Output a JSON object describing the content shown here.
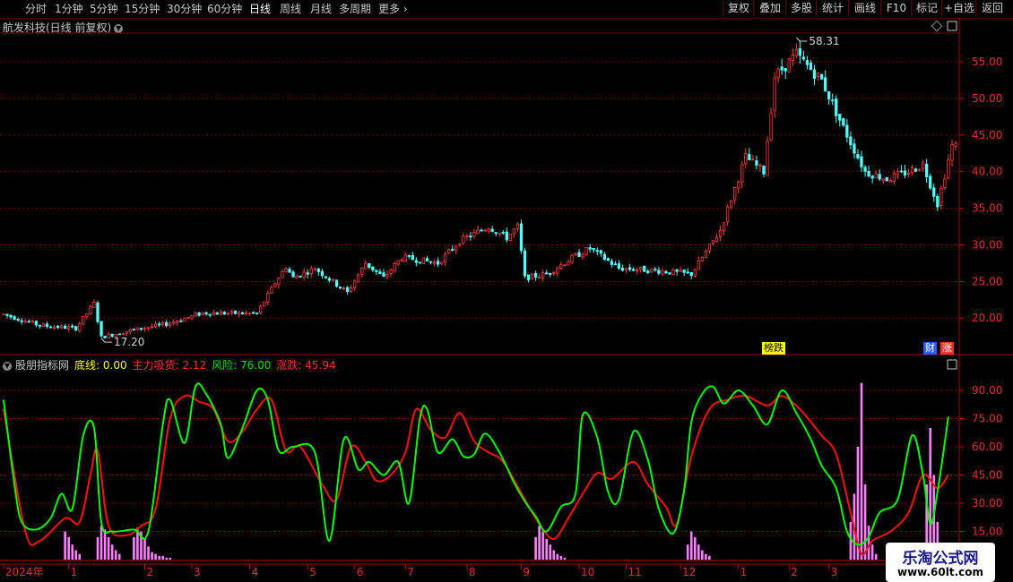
{
  "toolbar": {
    "periods": [
      "分时",
      "1分钟",
      "5分钟",
      "15分钟",
      "30分钟",
      "60分钟",
      "日线",
      "周线",
      "月线",
      "多周期",
      "更多"
    ],
    "active": "日线",
    "right_buttons": [
      "复权",
      "叠加",
      "多股",
      "统计",
      "画线",
      "F10",
      "标记",
      "+自选",
      "返回"
    ]
  },
  "main_title": "航发科技(日线 前复权)",
  "badges": {
    "bang": "榜跌",
    "cai": "财",
    "zhang": "涨"
  },
  "indicator": {
    "name": "股朋指标网",
    "items": [
      {
        "label": "底线: ",
        "value": "0.00",
        "color": "#ffff00"
      },
      {
        "label": "主力吸货: ",
        "value": "2.12",
        "color": "#ff3030"
      },
      {
        "label": "风险: ",
        "value": "76.00",
        "color": "#00e000"
      },
      {
        "label": "涨跌: ",
        "value": "45.94",
        "color": "#ff3030"
      }
    ]
  },
  "watermark": {
    "title": "乐淘公式网",
    "url": "www.60lt.com"
  },
  "colors": {
    "up": "#ff3a3a",
    "down": "#54ffff",
    "green_line": "#00ff00",
    "red_line": "#ff1010",
    "bars": "#ff80ff",
    "grid": "#7a0000"
  },
  "chart_data": [
    {
      "type": "candlestick",
      "ylim": [
        15.5,
        58.8
      ],
      "y_ticks": [
        "55.00",
        "50.00",
        "45.00",
        "40.00",
        "35.00",
        "30.00",
        "25.00",
        "20.00"
      ],
      "y_tick_values": [
        55,
        50,
        45,
        40,
        35,
        30,
        25,
        20
      ],
      "annotations": [
        {
          "text": "58.31",
          "value": 58.31,
          "bar_index": 219
        },
        {
          "text": "17.20",
          "value": 17.2,
          "bar_index": 27
        }
      ],
      "price_path": [
        [
          0,
          20.5
        ],
        [
          10,
          19.0
        ],
        [
          20,
          18.6
        ],
        [
          25,
          22
        ],
        [
          27,
          17.4
        ],
        [
          35,
          18.3
        ],
        [
          45,
          19.2
        ],
        [
          55,
          20.7
        ],
        [
          70,
          20.6
        ],
        [
          75,
          24.8
        ],
        [
          78,
          27
        ],
        [
          80,
          25.5
        ],
        [
          86,
          26.8
        ],
        [
          95,
          23.5
        ],
        [
          100,
          27.5
        ],
        [
          105,
          25.5
        ],
        [
          110,
          28.3
        ],
        [
          120,
          27.5
        ],
        [
          126,
          30.5
        ],
        [
          134,
          32.5
        ],
        [
          139,
          31
        ],
        [
          142,
          32.5
        ],
        [
          144,
          25.5
        ],
        [
          150,
          26
        ],
        [
          158,
          28.5
        ],
        [
          162,
          29.5
        ],
        [
          170,
          26.8
        ],
        [
          180,
          26.5
        ],
        [
          190,
          26
        ],
        [
          198,
          32
        ],
        [
          205,
          42
        ],
        [
          210,
          40
        ],
        [
          213,
          53
        ],
        [
          219,
          56
        ],
        [
          226,
          52.5
        ],
        [
          232,
          46
        ],
        [
          238,
          40
        ],
        [
          244,
          39
        ],
        [
          250,
          40
        ],
        [
          254,
          41
        ],
        [
          258,
          35.6
        ],
        [
          262,
          43.5
        ]
      ]
    },
    {
      "type": "line",
      "ylim": [
        0,
        100
      ],
      "y_ticks": [
        "90.00",
        "75.00",
        "60.00",
        "45.00",
        "30.00",
        "15.00"
      ],
      "y_tick_values": [
        90,
        75,
        60,
        45,
        30,
        15
      ],
      "series": [
        {
          "name": "风险",
          "color": "#00ff00",
          "values": [
            [
              0,
              85
            ],
            [
              3,
              40
            ],
            [
              5,
              20
            ],
            [
              9,
              16
            ],
            [
              13,
              22
            ],
            [
              16,
              35
            ],
            [
              19,
              27
            ],
            [
              22,
              66
            ],
            [
              25,
              70
            ],
            [
              27,
              20
            ],
            [
              30,
              15
            ],
            [
              36,
              16
            ],
            [
              40,
              15
            ],
            [
              44,
              72
            ],
            [
              46,
              85
            ],
            [
              50,
              62
            ],
            [
              53,
              92
            ],
            [
              56,
              88
            ],
            [
              60,
              72
            ],
            [
              62,
              54
            ],
            [
              66,
              70
            ],
            [
              70,
              90
            ],
            [
              73,
              85
            ],
            [
              76,
              58
            ],
            [
              80,
              60
            ],
            [
              86,
              57
            ],
            [
              90,
              10
            ],
            [
              94,
              64
            ],
            [
              98,
              48
            ],
            [
              101,
              52
            ],
            [
              105,
              45
            ],
            [
              109,
              52
            ],
            [
              112,
              30
            ],
            [
              115,
              75
            ],
            [
              117,
              80
            ],
            [
              120,
              57
            ],
            [
              124,
              64
            ],
            [
              127,
              55
            ],
            [
              130,
              56
            ],
            [
              133,
              67
            ],
            [
              137,
              57
            ],
            [
              141,
              41
            ],
            [
              144,
              31
            ],
            [
              147,
              23
            ],
            [
              150,
              15
            ],
            [
              154,
              28
            ],
            [
              158,
              35
            ],
            [
              160,
              77
            ],
            [
              164,
              65
            ],
            [
              167,
              36
            ],
            [
              170,
              32
            ],
            [
              174,
              68
            ],
            [
              178,
              53
            ],
            [
              181,
              27
            ],
            [
              185,
              14
            ],
            [
              188,
              37
            ],
            [
              190,
              73
            ],
            [
              193,
              88
            ],
            [
              196,
              92
            ],
            [
              199,
              83
            ],
            [
              203,
              90
            ],
            [
              207,
              82
            ],
            [
              211,
              72
            ],
            [
              215,
              90
            ],
            [
              219,
              78
            ],
            [
              223,
              64
            ],
            [
              226,
              50
            ],
            [
              230,
              38
            ],
            [
              233,
              15
            ],
            [
              236,
              8
            ],
            [
              239,
              12
            ],
            [
              242,
              25
            ],
            [
              247,
              32
            ],
            [
              251,
              66
            ],
            [
              254,
              45
            ],
            [
              256,
              19
            ],
            [
              258,
              36
            ],
            [
              261,
              76
            ]
          ]
        },
        {
          "name": "涨跌",
          "color": "#ff1010",
          "values": [
            [
              0,
              80
            ],
            [
              6,
              15
            ],
            [
              10,
              10
            ],
            [
              17,
              22
            ],
            [
              21,
              20
            ],
            [
              24,
              45
            ],
            [
              26,
              58
            ],
            [
              29,
              18
            ],
            [
              34,
              13
            ],
            [
              38,
              18
            ],
            [
              42,
              27
            ],
            [
              46,
              75
            ],
            [
              50,
              87
            ],
            [
              54,
              84
            ],
            [
              58,
              80
            ],
            [
              62,
              63
            ],
            [
              66,
              68
            ],
            [
              70,
              80
            ],
            [
              74,
              85
            ],
            [
              78,
              58
            ],
            [
              82,
              60
            ],
            [
              88,
              40
            ],
            [
              92,
              32
            ],
            [
              96,
              60
            ],
            [
              100,
              52
            ],
            [
              103,
              42
            ],
            [
              107,
              45
            ],
            [
              111,
              57
            ],
            [
              114,
              80
            ],
            [
              118,
              69
            ],
            [
              122,
              65
            ],
            [
              126,
              78
            ],
            [
              130,
              63
            ],
            [
              134,
              57
            ],
            [
              138,
              52
            ],
            [
              144,
              32
            ],
            [
              148,
              19
            ],
            [
              152,
              11
            ],
            [
              156,
              22
            ],
            [
              160,
              35
            ],
            [
              164,
              46
            ],
            [
              168,
              43
            ],
            [
              174,
              52
            ],
            [
              178,
              40
            ],
            [
              183,
              28
            ],
            [
              186,
              19
            ],
            [
              190,
              55
            ],
            [
              195,
              80
            ],
            [
              200,
              85
            ],
            [
              205,
              87
            ],
            [
              211,
              82
            ],
            [
              215,
              87
            ],
            [
              220,
              80
            ],
            [
              226,
              66
            ],
            [
              230,
              56
            ],
            [
              234,
              25
            ],
            [
              237,
              3
            ],
            [
              240,
              10
            ],
            [
              245,
              15
            ],
            [
              250,
              25
            ],
            [
              254,
              45
            ],
            [
              258,
              38
            ],
            [
              261,
              45
            ]
          ]
        },
        {
          "name": "主力吸货",
          "color": "#ff80ff",
          "bars": [
            [
              17,
              15
            ],
            [
              18,
              12
            ],
            [
              19,
              8
            ],
            [
              20,
              5
            ],
            [
              21,
              3
            ],
            [
              26,
              12
            ],
            [
              27,
              18
            ],
            [
              28,
              16
            ],
            [
              29,
              12
            ],
            [
              30,
              8
            ],
            [
              31,
              5
            ],
            [
              32,
              3
            ],
            [
              36,
              12
            ],
            [
              37,
              17
            ],
            [
              38,
              15
            ],
            [
              39,
              11
            ],
            [
              40,
              7
            ],
            [
              41,
              4
            ],
            [
              42,
              3
            ],
            [
              43,
              2
            ],
            [
              44,
              2
            ],
            [
              45,
              1
            ],
            [
              46,
              1
            ],
            [
              147,
              12
            ],
            [
              148,
              18
            ],
            [
              149,
              15
            ],
            [
              150,
              11
            ],
            [
              151,
              8
            ],
            [
              152,
              5
            ],
            [
              153,
              3
            ],
            [
              154,
              2
            ],
            [
              155,
              1
            ],
            [
              189,
              8
            ],
            [
              190,
              15
            ],
            [
              191,
              12
            ],
            [
              192,
              8
            ],
            [
              193,
              5
            ],
            [
              194,
              3
            ],
            [
              195,
              2
            ],
            [
              234,
              20
            ],
            [
              235,
              35
            ],
            [
              236,
              60
            ],
            [
              237,
              94
            ],
            [
              238,
              40
            ],
            [
              239,
              18
            ],
            [
              240,
              8
            ],
            [
              241,
              3
            ],
            [
              255,
              40
            ],
            [
              256,
              70
            ],
            [
              257,
              45
            ],
            [
              258,
              20
            ]
          ]
        }
      ],
      "x_tick_labels": [
        "2024年",
        "1",
        "2",
        "3",
        "4",
        "5",
        "6",
        "7",
        "8",
        "9",
        "10",
        "11",
        "12",
        "1",
        "2",
        "3"
      ],
      "x_tick_bars": [
        0,
        18,
        39,
        52,
        68,
        84,
        97,
        111,
        128,
        143,
        159,
        172,
        187,
        203,
        217,
        228
      ]
    }
  ]
}
